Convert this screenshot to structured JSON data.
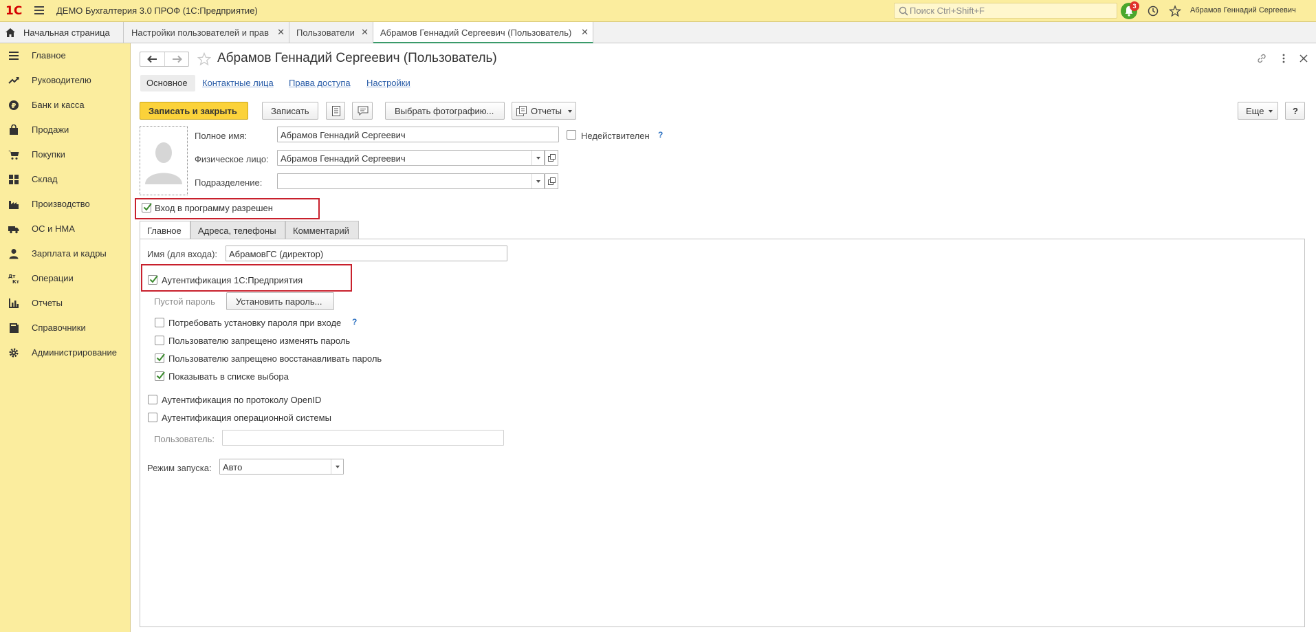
{
  "app": {
    "title": "ДЕМО Бухгалтерия 3.0 ПРОФ  (1С:Предприятие)",
    "logo_text": "1С",
    "search_placeholder": "Поиск Ctrl+Shift+F",
    "notifications_count": "3",
    "user_name": "Абрамов Геннадий Сергеевич"
  },
  "tabs": {
    "home": "Начальная страница",
    "open": [
      {
        "label": "Настройки пользователей и прав"
      },
      {
        "label": "Пользователи"
      },
      {
        "label": "Абрамов Геннадий Сергеевич (Пользователь)"
      }
    ]
  },
  "sidebar": {
    "items": [
      {
        "label": "Главное",
        "icon": "menu-icon"
      },
      {
        "label": "Руководителю",
        "icon": "trend-icon"
      },
      {
        "label": "Банк и касса",
        "icon": "ruble-icon"
      },
      {
        "label": "Продажи",
        "icon": "bag-icon"
      },
      {
        "label": "Покупки",
        "icon": "cart-icon"
      },
      {
        "label": "Склад",
        "icon": "grid-icon"
      },
      {
        "label": "Производство",
        "icon": "factory-icon"
      },
      {
        "label": "ОС и НМА",
        "icon": "truck-icon"
      },
      {
        "label": "Зарплата и кадры",
        "icon": "person-icon"
      },
      {
        "label": "Операции",
        "icon": "dt-kt-icon"
      },
      {
        "label": "Отчеты",
        "icon": "bar-chart-icon"
      },
      {
        "label": "Справочники",
        "icon": "book-icon"
      },
      {
        "label": "Администрирование",
        "icon": "gear-icon"
      }
    ]
  },
  "form": {
    "title": "Абрамов Геннадий Сергеевич (Пользователь)",
    "subnav": {
      "main": "Основное",
      "contacts": "Контактные лица",
      "rights": "Права доступа",
      "settings": "Настройки"
    },
    "toolbar": {
      "save_close": "Записать и закрыть",
      "save": "Записать",
      "choose_photo": "Выбрать фотографию...",
      "reports": "Отчеты",
      "more": "Еще",
      "help": "?"
    },
    "fields": {
      "full_name_label": "Полное имя:",
      "full_name": "Абрамов Геннадий Сергеевич",
      "invalid_label": "Недействителен",
      "person_label": "Физическое лицо:",
      "person": "Абрамов Геннадий Сергеевич",
      "department_label": "Подразделение:",
      "department": ""
    },
    "login_allowed": "Вход в программу разрешен",
    "inner_tabs": [
      "Главное",
      "Адреса, телефоны",
      "Комментарий"
    ],
    "main_tab": {
      "login_name_label": "Имя (для входа):",
      "login_name": "АбрамовГС (директор)",
      "auth_1c": "Аутентификация 1С:Предприятия",
      "empty_password": "Пустой пароль",
      "set_password": "Установить пароль...",
      "require_password_change": "Потребовать установку пароля при входе",
      "forbid_change": "Пользователю запрещено изменять пароль",
      "forbid_restore": "Пользователю запрещено восстанавливать пароль",
      "show_in_list": "Показывать в списке выбора",
      "auth_openid": "Аутентификация по протоколу OpenID",
      "auth_os": "Аутентификация операционной системы",
      "os_user_label": "Пользователь:",
      "os_user": "",
      "launch_mode_label": "Режим запуска:",
      "launch_mode": "Авто"
    },
    "help_mark": "?"
  },
  "colors": {
    "sidebar_bg": "#fbed9e",
    "primary_button": "#fbd23a",
    "link": "#2a5da8",
    "highlight": "#c8202c",
    "notification": "#4aa72d"
  }
}
